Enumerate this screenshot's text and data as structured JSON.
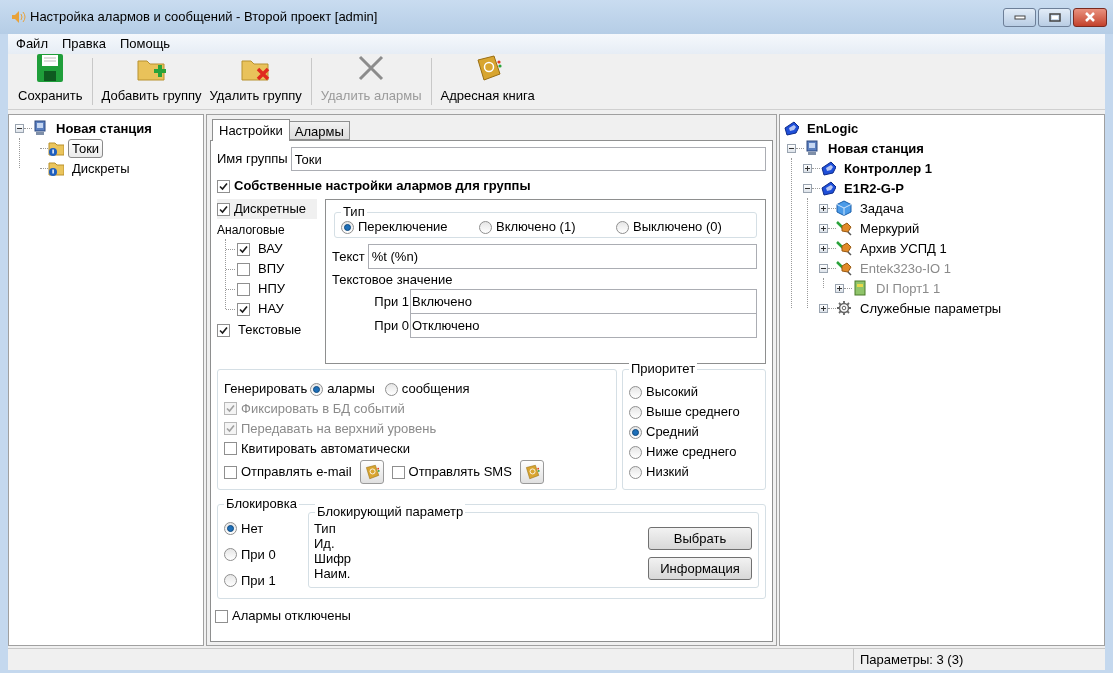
{
  "window": {
    "title": "Настройка алармов и сообщений - Второй проект [admin]"
  },
  "menu": [
    {
      "label": "Файл"
    },
    {
      "label": "Правка"
    },
    {
      "label": "Помощь"
    }
  ],
  "toolbar": [
    {
      "kind": "save",
      "label": "Сохранить",
      "disabled": false
    },
    {
      "kind": "add",
      "label": "Добавить группу",
      "disabled": false
    },
    {
      "kind": "remove",
      "label": "Удалить группу",
      "disabled": false
    },
    {
      "kind": "clear",
      "label": "Удалить алармы",
      "disabled": true
    },
    {
      "kind": "book",
      "label": "Адресная книга",
      "disabled": false
    }
  ],
  "left_tree": [
    {
      "kind": "station",
      "label": "Новая станция",
      "bold": true,
      "expanded": true,
      "children": [
        {
          "kind": "folder",
          "label": "Токи",
          "selected": true
        },
        {
          "kind": "folder",
          "label": "Дискреты",
          "selected": false
        }
      ]
    }
  ],
  "tabs": [
    {
      "label": "Настройки",
      "selected": true
    },
    {
      "label": "Алармы",
      "selected": false
    }
  ],
  "group_name": {
    "label": "Имя группы",
    "value": "Токи"
  },
  "own_settings": {
    "label": "Собственные настройки алармов для группы",
    "checked": true
  },
  "discrete": {
    "label": "Дискретные",
    "checked": true
  },
  "analog": {
    "label": "Аналоговые",
    "items": [
      {
        "label": "ВАУ",
        "checked": true
      },
      {
        "label": "ВПУ",
        "checked": false
      },
      {
        "label": "НПУ",
        "checked": false
      },
      {
        "label": "НАУ",
        "checked": true
      }
    ]
  },
  "textual": {
    "label": "Текстовые",
    "checked": true
  },
  "type_group": {
    "title": "Тип",
    "options": [
      {
        "label": "Переключение",
        "selected": true
      },
      {
        "label": "Включено (1)",
        "selected": false
      },
      {
        "label": "Выключено (0)",
        "selected": false
      }
    ]
  },
  "text_field": {
    "label": "Текст",
    "value": "%t (%n)"
  },
  "text_value": {
    "title": "Текстовое значение",
    "rows": [
      {
        "label": "При 1",
        "value": "Включено"
      },
      {
        "label": "При 0",
        "value": "Отключено"
      }
    ]
  },
  "generate": {
    "label": "Генерировать",
    "options": [
      {
        "label": "алармы",
        "selected": true
      },
      {
        "label": "сообщения",
        "selected": false
      }
    ]
  },
  "options": [
    {
      "label": "Фиксировать в БД событий",
      "checked": true,
      "disabled": true
    },
    {
      "label": "Передавать на верхний уровень",
      "checked": true,
      "disabled": true
    },
    {
      "label": "Квитировать автоматически",
      "checked": false,
      "disabled": false
    }
  ],
  "notify": [
    {
      "label": "Отправлять e-mail",
      "checked": false
    },
    {
      "label": "Отправлять SMS",
      "checked": false
    }
  ],
  "priority": {
    "title": "Приоритет",
    "options": [
      {
        "label": "Высокий",
        "selected": false
      },
      {
        "label": "Выше среднего",
        "selected": false
      },
      {
        "label": "Средний",
        "selected": true
      },
      {
        "label": "Ниже среднего",
        "selected": false
      },
      {
        "label": "Низкий",
        "selected": false
      }
    ]
  },
  "blocking": {
    "title": "Блокировка",
    "options": [
      {
        "label": "Нет",
        "selected": true
      },
      {
        "label": "При 0",
        "selected": false
      },
      {
        "label": "При 1",
        "selected": false
      }
    ],
    "param": {
      "title": "Блокирующий параметр",
      "fields": [
        "Тип",
        "Ид.",
        "Шифр",
        "Наим."
      ],
      "buttons": [
        "Выбрать",
        "Информация"
      ]
    }
  },
  "alarms_off": {
    "label": "Алармы отключены",
    "checked": false
  },
  "right_tree": [
    {
      "kind": "logic",
      "label": "EnLogic",
      "bold": true,
      "children": [
        {
          "kind": "station",
          "label": "Новая станция",
          "bold": true,
          "expanded": true,
          "children": [
            {
              "kind": "logic",
              "label": "Контроллер 1",
              "bold": true,
              "expanded": false
            },
            {
              "kind": "logic",
              "label": "E1R2-G-P",
              "bold": true,
              "expanded": true,
              "children": [
                {
                  "kind": "cube",
                  "label": "Задача",
                  "expanded": false
                },
                {
                  "kind": "plug",
                  "label": "Меркурий",
                  "expanded": false
                },
                {
                  "kind": "plug",
                  "label": "Архив УСПД 1",
                  "expanded": false
                },
                {
                  "kind": "plug",
                  "label": "Entek323o-IO 1",
                  "expanded": true,
                  "disabled": true,
                  "children": [
                    {
                      "kind": "port",
                      "label": "DI Порт1 1",
                      "expanded": false,
                      "disabled": true
                    }
                  ]
                },
                {
                  "kind": "gear",
                  "label": "Служебные параметры",
                  "expanded": false
                }
              ]
            }
          ]
        }
      ]
    }
  ],
  "status_bar": {
    "text": "Параметры: 3 (3)"
  }
}
